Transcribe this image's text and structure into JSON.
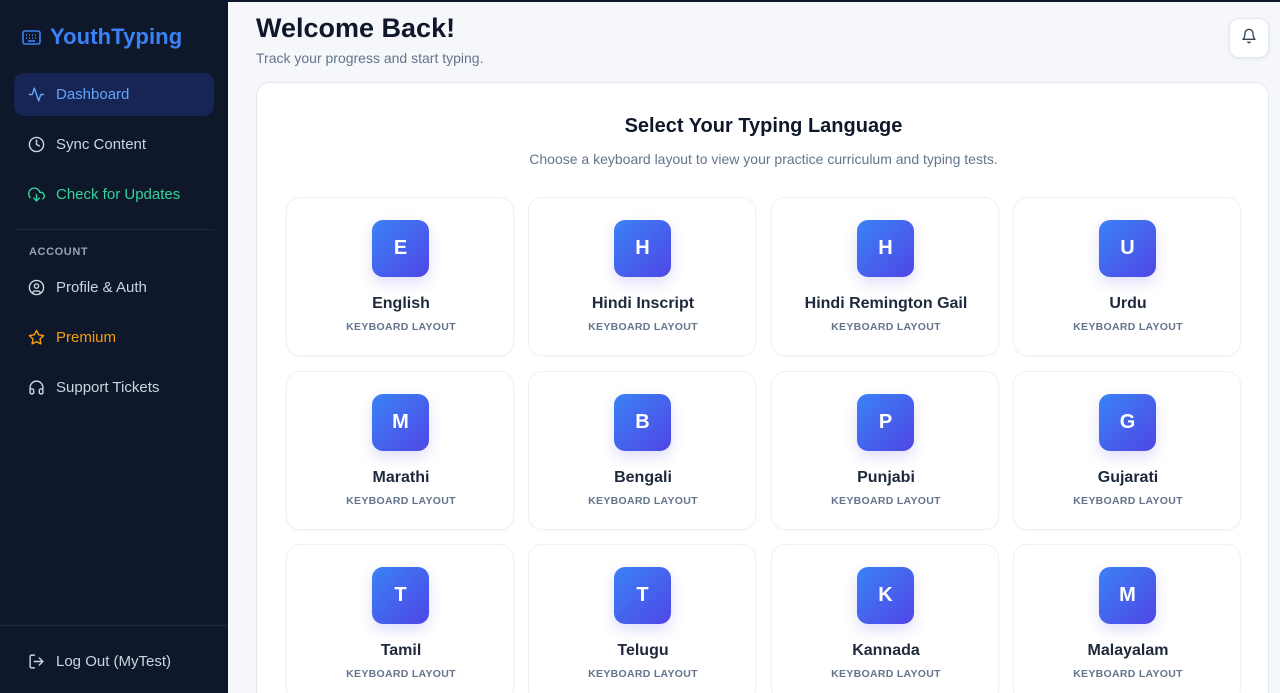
{
  "brand": {
    "name": "YouthTyping",
    "icon": "keyboard-icon"
  },
  "sidebar": {
    "nav": [
      {
        "label": "Dashboard",
        "icon": "activity-icon"
      },
      {
        "label": "Sync Content",
        "icon": "clock-icon"
      },
      {
        "label": "Check for Updates",
        "icon": "cloud-download-icon"
      }
    ],
    "account_label": "ACCOUNT",
    "account": [
      {
        "label": "Profile & Auth",
        "icon": "user-circle-icon"
      },
      {
        "label": "Premium",
        "icon": "star-icon"
      },
      {
        "label": "Support Tickets",
        "icon": "headset-icon"
      }
    ],
    "logout": {
      "label": "Log Out (MyTest)",
      "icon": "logout-icon"
    }
  },
  "header": {
    "title": "Welcome Back!",
    "subtitle": "Track your progress and start typing.",
    "bell_icon": "bell-icon"
  },
  "main": {
    "title": "Select Your Typing Language",
    "subtitle": "Choose a keyboard layout to view your practice curriculum and typing tests.",
    "languages": [
      {
        "letter": "E",
        "name": "English",
        "sub": "KEYBOARD LAYOUT"
      },
      {
        "letter": "H",
        "name": "Hindi Inscript",
        "sub": "KEYBOARD LAYOUT"
      },
      {
        "letter": "H",
        "name": "Hindi Remington Gail",
        "sub": "KEYBOARD LAYOUT"
      },
      {
        "letter": "U",
        "name": "Urdu",
        "sub": "KEYBOARD LAYOUT"
      },
      {
        "letter": "M",
        "name": "Marathi",
        "sub": "KEYBOARD LAYOUT"
      },
      {
        "letter": "B",
        "name": "Bengali",
        "sub": "KEYBOARD LAYOUT"
      },
      {
        "letter": "P",
        "name": "Punjabi",
        "sub": "KEYBOARD LAYOUT"
      },
      {
        "letter": "G",
        "name": "Gujarati",
        "sub": "KEYBOARD LAYOUT"
      },
      {
        "letter": "T",
        "name": "Tamil",
        "sub": "KEYBOARD LAYOUT"
      },
      {
        "letter": "T",
        "name": "Telugu",
        "sub": "KEYBOARD LAYOUT"
      },
      {
        "letter": "K",
        "name": "Kannada",
        "sub": "KEYBOARD LAYOUT"
      },
      {
        "letter": "M",
        "name": "Malayalam",
        "sub": "KEYBOARD LAYOUT"
      }
    ]
  },
  "colors": {
    "sidebar_bg": "#0f172a",
    "accent": "#3b82f6",
    "active_bg": "#172554",
    "update_green": "#34d399",
    "premium_amber": "#f59e0b",
    "badge_gradient": [
      "#3b82f6",
      "#4f46e5"
    ]
  }
}
